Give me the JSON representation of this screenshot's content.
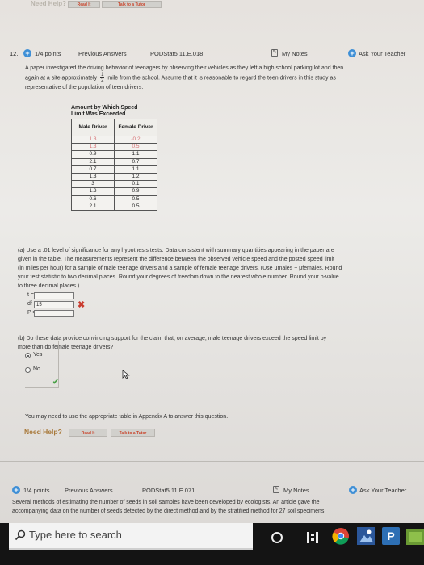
{
  "top_strip": {
    "need_help": "Need Help?",
    "read_it": "Read It",
    "talk_to_tutor": "Talk to a Tutor"
  },
  "question12": {
    "number": "12.",
    "points": "1/4 points",
    "previous_answers": "Previous Answers",
    "code": "PODStat5 11.E.018.",
    "my_notes": "My Notes",
    "ask_teacher": "Ask Your Teacher",
    "intro_1": "A paper investigated the driving behavior of teenagers by observing their vehicles as they left a high school parking lot and then",
    "intro_2a": "again at a site approximately",
    "frac_num": "1",
    "frac_den": "2",
    "intro_2b": "mile from the school. Assume that it is reasonable to regard the teen drivers in this study as",
    "intro_3": "representative of the population of teen drivers.",
    "table_title_1": "Amount by Which Speed",
    "table_title_2": "Limit Was Exceeded",
    "table": {
      "col1": "Male Driver",
      "col2": "Female Driver",
      "rows": [
        [
          "1.3",
          "-0.2"
        ],
        [
          "1.3",
          "0.5"
        ],
        [
          "0.9",
          "1.1"
        ],
        [
          "2.1",
          "0.7"
        ],
        [
          "0.7",
          "1.1"
        ],
        [
          "1.3",
          "1.2"
        ],
        [
          "3",
          "0.1"
        ],
        [
          "1.3",
          "0.9"
        ],
        [
          "0.6",
          "0.5"
        ],
        [
          "2.1",
          "0.5"
        ]
      ]
    },
    "part_a_1": "(a) Use a .01 level of significance for any hypothesis tests. Data consistent with summary quantities appearing in the paper are",
    "part_a_2": "given in the table. The measurements represent the difference between the observed vehicle speed and the posted speed limit",
    "part_a_3": "(in miles per hour) for a sample of male teenage drivers and a sample of female teenage drivers. (Use μmales − μfemales. Round",
    "part_a_4": "your test statistic to two decimal places. Round your degrees of freedom down to the nearest whole number. Round your p-value",
    "part_a_5": "to three decimal places.)",
    "t_label": "t =",
    "t_value": "",
    "df_label": "df =",
    "df_value": "15",
    "p_label": "P =",
    "p_value": "",
    "wrong_mark": "✖",
    "part_b_1": "(b) Do these data provide convincing support for the claim that, on average, male teenage drivers exceed the speed limit by",
    "part_b_2": "more than do female teenage drivers?",
    "option_yes": "Yes",
    "option_no": "No",
    "correct_mark": "✔",
    "appendix_note": "You may need to use the appropriate table in Appendix A to answer this question.",
    "need_help": "Need Help?",
    "read_it": "Read It",
    "talk_to_tutor": "Talk to a Tutor"
  },
  "question13": {
    "points": "1/4 points",
    "previous_answers": "Previous Answers",
    "code": "PODStat5 11.E.071.",
    "my_notes": "My Notes",
    "ask_teacher": "Ask Your Teacher",
    "intro_1": "Several methods of estimating the number of seeds in soil samples have been developed by ecologists. An article gave the",
    "intro_2": "accompanying data on the number of seeds detected by the direct method and by the stratified method for 27 soil specimens."
  },
  "taskbar": {
    "search_placeholder": "Type here to search"
  },
  "colors": {
    "accent_blue": "#3f8fd6",
    "error_red": "#c93b2e",
    "correct_green": "#4aa047",
    "need_help_gold": "#a8793a",
    "taskbar": "#141414"
  }
}
